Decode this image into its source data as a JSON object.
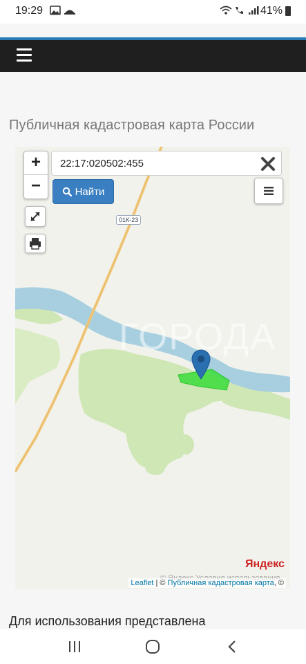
{
  "status": {
    "time": "19:29",
    "battery": "41%"
  },
  "page": {
    "title": "Публичная кадастровая карта России",
    "bottom_text": "Для использования представлена"
  },
  "map": {
    "search_value": "22:17:020502:455",
    "find_label": "Найти",
    "road_label": "01К-23",
    "watermark": "ГОРОДА",
    "yandex_logo": "Яндекс",
    "yandex_terms": "© Яндекс  Условия использования",
    "attribution": {
      "leaflet": "Leaflet",
      "sep": " | © ",
      "cadastral": "Публичная кадастровая карта",
      "tail": ", ©"
    },
    "colors": {
      "water": "#a7cfe0",
      "forest": "#cfe6b5",
      "parcel": "#3bdc3b",
      "marker": "#2a6fb0",
      "road": "#f1c87a"
    }
  }
}
